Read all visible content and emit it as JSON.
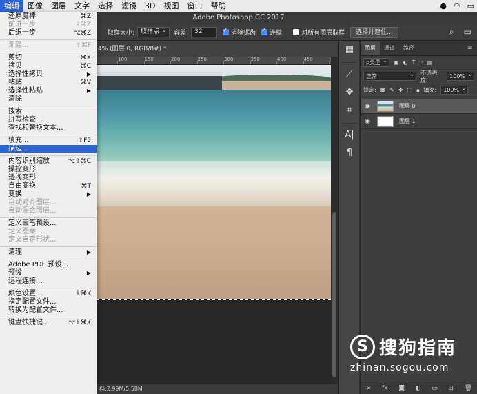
{
  "menubar": {
    "items": [
      "编辑",
      "图像",
      "图层",
      "文字",
      "选择",
      "滤镜",
      "3D",
      "视图",
      "窗口",
      "帮助"
    ],
    "active_index": 0
  },
  "window": {
    "title": "Adobe Photoshop CC 2017"
  },
  "options": {
    "sample_size_label": "取样大小:",
    "sample_size_value": "取样点",
    "tolerance_label": "容差:",
    "tolerance_value": "32",
    "antialias_label": "消除锯齿",
    "contiguous_label": "连续",
    "all_layers_label": "对所有图层取样",
    "select_mask_button": "选择并遮住..."
  },
  "document": {
    "tab_title": "4% (图层 0, RGB/8#) *",
    "ruler_labels": [
      "100",
      "150",
      "200",
      "250",
      "300",
      "350",
      "400",
      "450",
      "500"
    ],
    "status": "档:2.99M/5.58M"
  },
  "layers_panel": {
    "tabs": [
      "图层",
      "通道",
      "路径"
    ],
    "kind_label": "ρ类型",
    "blend_mode": "正常",
    "opacity_label": "不透明度:",
    "opacity_value": "100%",
    "lock_label": "锁定:",
    "fill_label": "填充:",
    "fill_value": "100%",
    "layers": [
      {
        "name": "图层 0",
        "selected": true
      },
      {
        "name": "图层 1",
        "selected": false
      }
    ]
  },
  "edit_menu": {
    "groups": [
      [
        {
          "label": "还原魔棒",
          "shortcut": "⌘Z"
        },
        {
          "label": "前进一步",
          "shortcut": "⇧⌘Z",
          "disabled": true
        },
        {
          "label": "后退一步",
          "shortcut": "⌥⌘Z"
        }
      ],
      [
        {
          "label": "渐隐...",
          "shortcut": "⇧⌘F",
          "disabled": true
        }
      ],
      [
        {
          "label": "剪切",
          "shortcut": "⌘X"
        },
        {
          "label": "拷贝",
          "shortcut": "⌘C"
        },
        {
          "label": "选择性拷贝",
          "submenu": true
        },
        {
          "label": "粘贴",
          "shortcut": "⌘V"
        },
        {
          "label": "选择性粘贴",
          "submenu": true
        },
        {
          "label": "清除"
        }
      ],
      [
        {
          "label": "搜索"
        },
        {
          "label": "拼写检查..."
        },
        {
          "label": "查找和替换文本..."
        }
      ],
      [
        {
          "label": "填充...",
          "shortcut": "⇧F5"
        },
        {
          "label": "描边...",
          "highlighted": true
        }
      ],
      [
        {
          "label": "内容识别缩放",
          "shortcut": "⌥⇧⌘C"
        },
        {
          "label": "操控变形"
        },
        {
          "label": "透视变形"
        },
        {
          "label": "自由变换",
          "shortcut": "⌘T"
        },
        {
          "label": "变换",
          "submenu": true
        },
        {
          "label": "自动对齐图层...",
          "disabled": true
        },
        {
          "label": "自动混合图层...",
          "disabled": true
        }
      ],
      [
        {
          "label": "定义画笔预设..."
        },
        {
          "label": "定义图案...",
          "disabled": true
        },
        {
          "label": "定义自定形状...",
          "disabled": true
        }
      ],
      [
        {
          "label": "清理",
          "submenu": true
        }
      ],
      [
        {
          "label": "Adobe PDF 预设..."
        },
        {
          "label": "预设",
          "submenu": true
        },
        {
          "label": "远程连接..."
        }
      ],
      [
        {
          "label": "颜色设置...",
          "shortcut": "⇧⌘K"
        },
        {
          "label": "指定配置文件..."
        },
        {
          "label": "转换为配置文件..."
        }
      ],
      [
        {
          "label": "键盘快捷键...",
          "shortcut": "⌥⇧⌘K"
        }
      ]
    ]
  },
  "watermark": {
    "brand": "搜狗指南",
    "url": "zhinan.sogou.com"
  }
}
